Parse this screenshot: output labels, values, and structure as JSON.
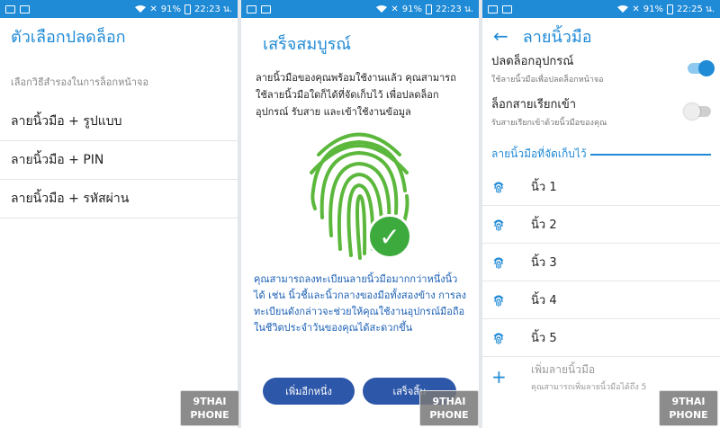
{
  "status": {
    "left": {
      "battery": "91%",
      "time": "22:23 น."
    },
    "middle": {
      "battery": "91%",
      "time": "22:23 น."
    },
    "right": {
      "battery": "91%",
      "time": "22:25 น."
    }
  },
  "panel1": {
    "title": "ตัวเลือกปลดล็อก",
    "subtitle": "เลือกวิธีสำรองในการล็อกหน้าจอ",
    "options": [
      "ลายนิ้วมือ + รูปแบบ",
      "ลายนิ้วมือ + PIN",
      "ลายนิ้วมือ + รหัสผ่าน"
    ]
  },
  "panel2": {
    "title": "เสร็จสมบูรณ์",
    "description": "ลายนิ้วมือของคุณพร้อมใช้งานแล้ว คุณสามารถใช้ลายนิ้วมือใดก็ได้ที่จัดเก็บไว้ เพื่อปลดล็อกอุปกรณ์ รับสาย และเข้าใช้งานข้อมูล",
    "info": "คุณสามารถลงทะเบียนลายนิ้วมือมากกว่าหนึ่งนิ้วได้ เช่น นิ้วชี้และนิ้วกลางของมือทั้งสองข้าง การลงทะเบียนดังกล่าวจะช่วยให้คุณใช้งานอุปกรณ์มือถือในชีวิตประจำวันของคุณได้สะดวกขึ้น",
    "btn_more": "เพิ่มอีกหนึ่ง",
    "btn_done": "เสร็จสิ้น",
    "colors": {
      "fingerprint": "#5cb83c",
      "check": "#3caa3c",
      "button": "#2d57a8"
    }
  },
  "panel3": {
    "title": "ลายนิ้วมือ",
    "toggles": [
      {
        "title": "ปลดล็อกอุปกรณ์",
        "subtitle": "ใช้ลายนิ้วมือเพื่อปลดล็อกหน้าจอ",
        "on": true
      },
      {
        "title": "ล็อกสายเรียกเข้า",
        "subtitle": "รับสายเรียกเข้าด้วยนิ้วมือของคุณ",
        "on": false
      }
    ],
    "section": "ลายนิ้วมือที่จัดเก็บไว้",
    "fingers": [
      "นิ้ว 1",
      "นิ้ว 2",
      "นิ้ว 3",
      "นิ้ว 4",
      "นิ้ว 5"
    ],
    "add_title": "เพิ่มลายนิ้วมือ",
    "add_sub": "คุณสามารถเพิ่มลายนิ้วมือได้ถึง 5"
  },
  "watermark": {
    "line1": "9THAI",
    "line2": "PHONE"
  },
  "accent": "#1f8ad6"
}
